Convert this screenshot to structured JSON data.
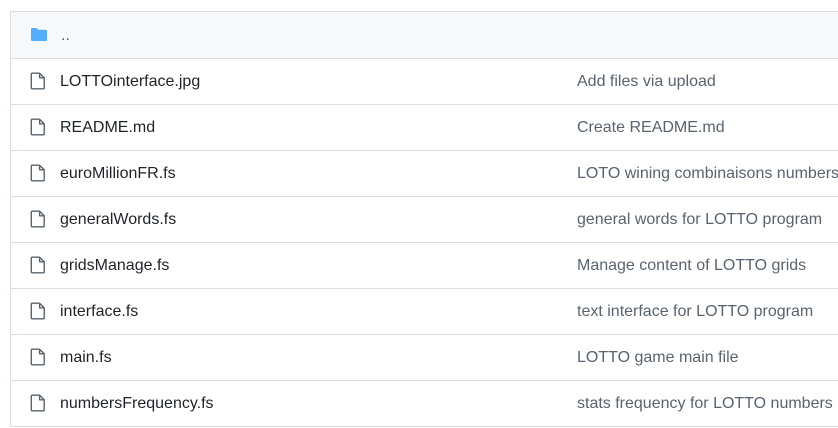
{
  "parent_row": {
    "label": "..",
    "icon": "folder-icon",
    "icon_color": "#54aeff"
  },
  "files": [
    {
      "name": "LOTTOinterface.jpg",
      "message": "Add files via upload",
      "icon": "file-icon"
    },
    {
      "name": "README.md",
      "message": "Create README.md",
      "icon": "file-icon"
    },
    {
      "name": "euroMillionFR.fs",
      "message": "LOTO wining combinaisons numbers",
      "icon": "file-icon"
    },
    {
      "name": "generalWords.fs",
      "message": "general words for LOTTO program",
      "icon": "file-icon"
    },
    {
      "name": "gridsManage.fs",
      "message": "Manage content of LOTTO grids",
      "icon": "file-icon"
    },
    {
      "name": "interface.fs",
      "message": "text interface for LOTTO program",
      "icon": "file-icon"
    },
    {
      "name": "main.fs",
      "message": "LOTTO game main file",
      "icon": "file-icon"
    },
    {
      "name": "numbersFrequency.fs",
      "message": "stats frequency for LOTTO numbers",
      "icon": "file-icon"
    }
  ],
  "colors": {
    "file_name": "#1f2328",
    "commit_message": "#59636e",
    "border": "#d8dee4",
    "folder_icon": "#54aeff"
  }
}
